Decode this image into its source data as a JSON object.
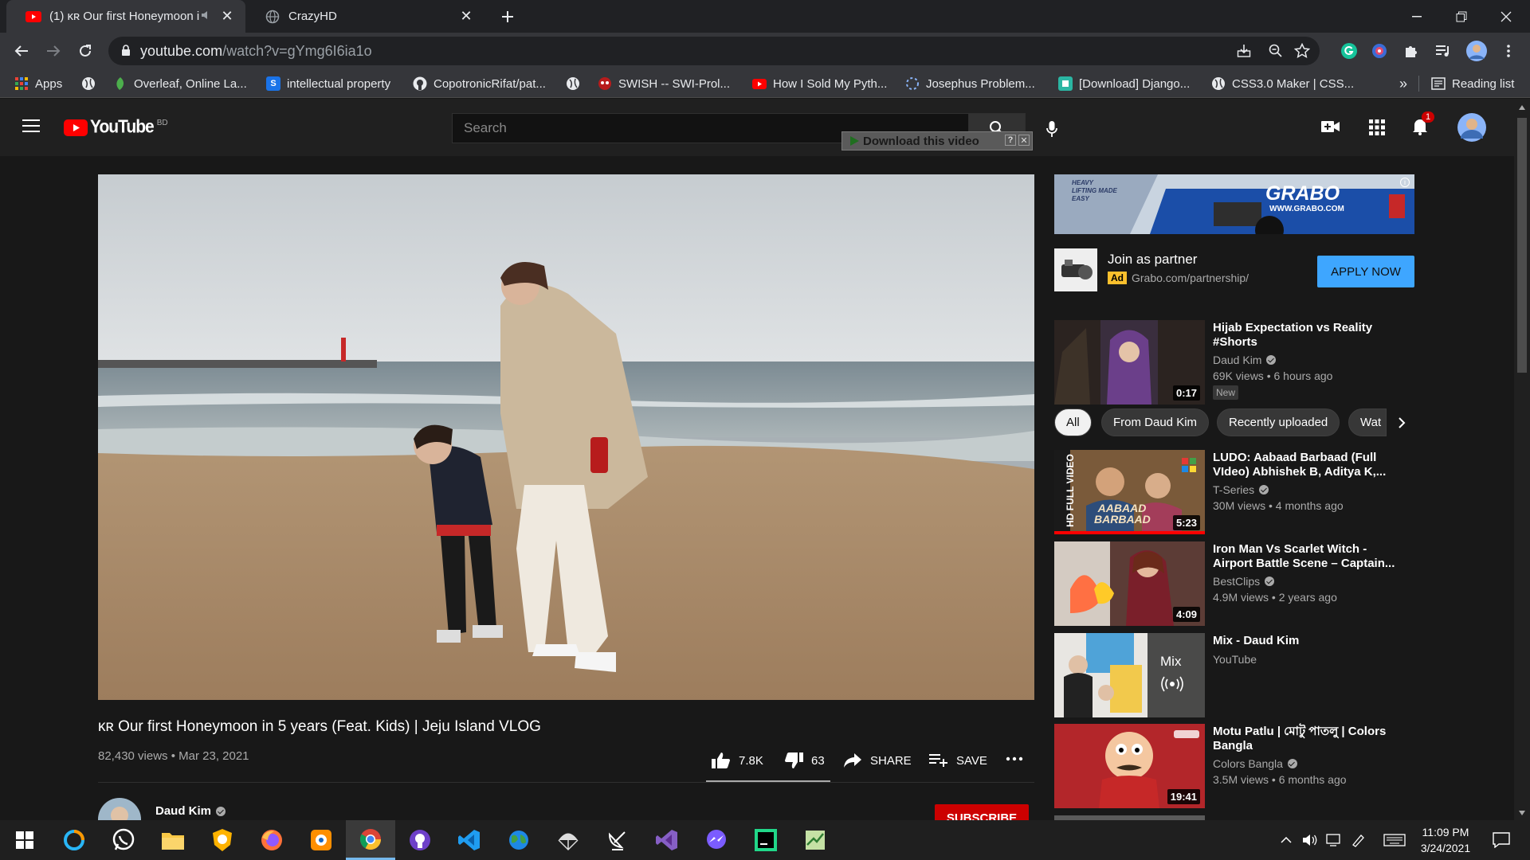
{
  "browser": {
    "tabs": [
      {
        "title": "(1) ᴋʀ Our first Honeymoon i",
        "active": true
      },
      {
        "title": "CrazyHD",
        "active": false
      }
    ],
    "address": {
      "host": "youtube.com",
      "path": "/watch?v=gYmg6I6ia1o"
    },
    "bookmarks": [
      {
        "label": "Apps"
      },
      {
        "label": ""
      },
      {
        "label": "Overleaf, Online La..."
      },
      {
        "label": "intellectual property"
      },
      {
        "label": "CopotronicRifat/pat..."
      },
      {
        "label": ""
      },
      {
        "label": "SWISH -- SWI-Prol..."
      },
      {
        "label": "How I Sold My Pyth..."
      },
      {
        "label": "Josephus Problem..."
      },
      {
        "label": "[Download] Django..."
      },
      {
        "label": "CSS3.0 Maker | CSS..."
      }
    ],
    "reading_list": "Reading list",
    "overflow": "»"
  },
  "youtube": {
    "logo_text": "YouTube",
    "country": "BD",
    "search_placeholder": "Search",
    "download_bar": "Download this video",
    "notif_count": "1"
  },
  "video": {
    "title": "ᴋʀ Our first Honeymoon in 5 years (Feat. Kids) | Jeju Island VLOG",
    "views_date": "82,430 views • Mar 23, 2021",
    "likes": "7.8K",
    "dislikes": "63",
    "share": "SHARE",
    "save": "SAVE",
    "channel": "Daud Kim",
    "subscribe": "SUBSCRIBE"
  },
  "ad": {
    "banner_text": "GRABO",
    "banner_url": "WWW.GRABO.COM",
    "banner_tagline": "HEAVY LIFTING MADE EASY",
    "title": "Join as partner",
    "badge": "Ad",
    "url": "Grabo.com/partnership/",
    "cta": "APPLY NOW"
  },
  "chips": [
    "All",
    "From Daud Kim",
    "Recently uploaded",
    "Wat"
  ],
  "related": [
    {
      "title": "Hijab Expectation vs Reality #Shorts",
      "channel": "Daud Kim",
      "verified": true,
      "meta": "69K views • 6 hours ago",
      "badge": "New",
      "duration": "0:17"
    },
    {
      "title": "LUDO: Aabaad Barbaad (Full VIdeo) Abhishek B, Aditya K,...",
      "channel": "T-Series",
      "verified": true,
      "meta": "30M views • 4 months ago",
      "duration": "5:23",
      "thumb_side_label": "HD FULL VIDEO",
      "thumb_caption": "AABAAD BARBAAD"
    },
    {
      "title": "Iron Man Vs Scarlet Witch - Airport Battle Scene – Captain...",
      "channel": "BestClips",
      "verified": true,
      "meta": "4.9M views • 2 years ago",
      "duration": "4:09"
    },
    {
      "title": "Mix - Daud Kim",
      "channel": "YouTube",
      "verified": false,
      "meta": "",
      "mix_label": "Mix"
    },
    {
      "title": "Motu Patlu | মোটু পাতলু | Colors Bangla",
      "channel": "Colors Bangla",
      "verified": true,
      "meta": "3.5M views • 6 months ago",
      "duration": "19:41"
    }
  ],
  "taskbar": {
    "time": "11:09 PM",
    "date": "3/24/2021"
  }
}
